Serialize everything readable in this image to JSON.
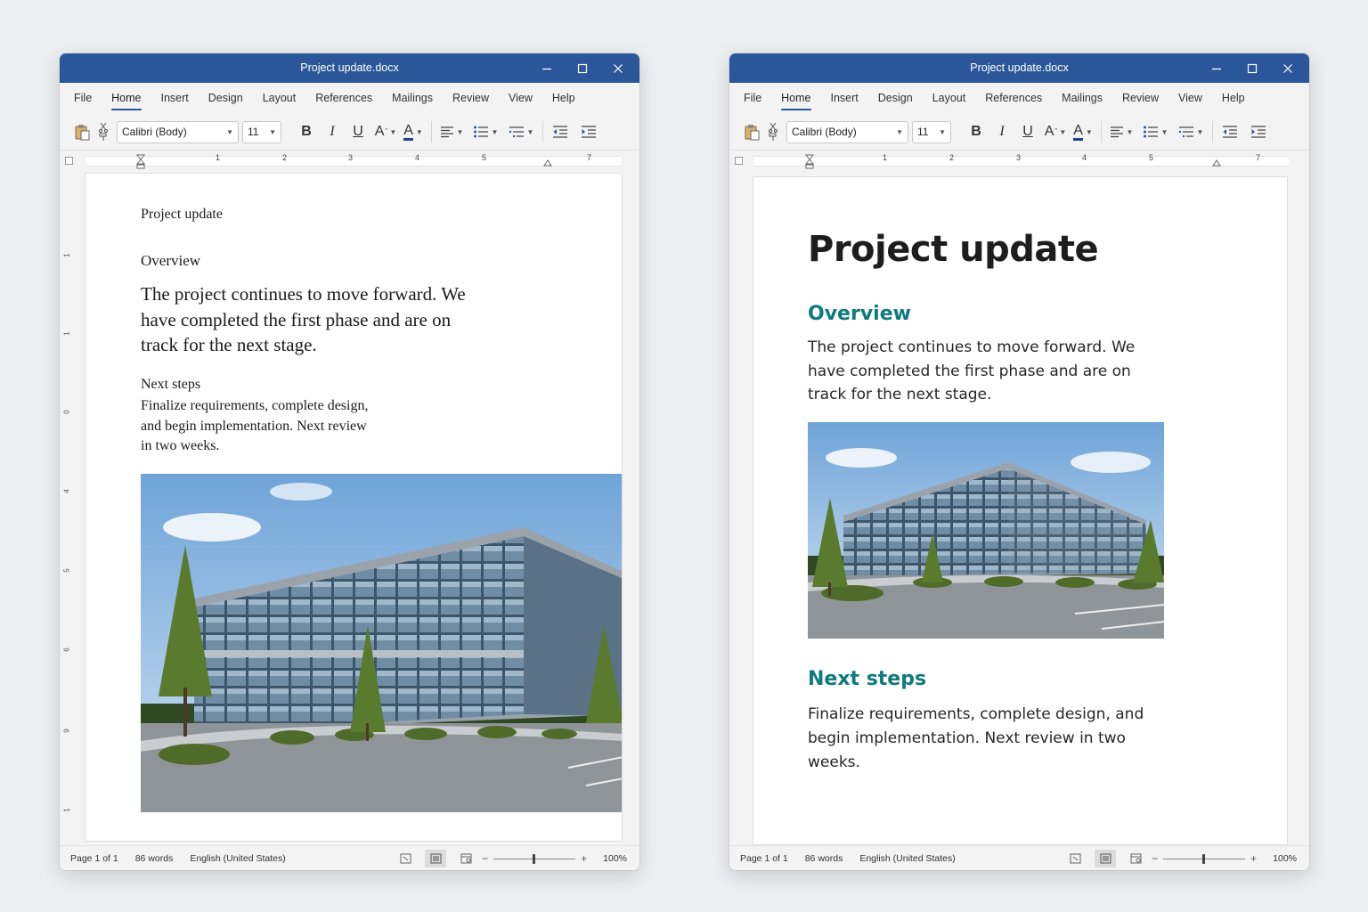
{
  "windows": [
    {
      "id": "left",
      "title": "Project update.docx",
      "menu": [
        "File",
        "Home",
        "Insert",
        "Design",
        "Layout",
        "References",
        "Mailings",
        "Review",
        "View",
        "Help"
      ],
      "active_menu": "Home",
      "font_name": "Calibri (Body)",
      "font_size": "11",
      "ruler_numbers": [
        "1",
        "2",
        "3",
        "4",
        "5",
        "7"
      ],
      "vruler_numbers": [
        "1",
        "1",
        "0",
        "4",
        "5",
        "6",
        "9",
        "1"
      ],
      "document": {
        "title": "Project update",
        "overview_heading": "Overview",
        "overview_text": "The project continues to move forward. We have completed the first phase and are on track for the next stage.",
        "next_heading": "Next steps",
        "next_text": "Finalize requirements, complete design, and begin implementation. Next review in two weeks."
      },
      "status": {
        "page": "Page 1 of 1",
        "words": "86 words",
        "language": "English (United States)",
        "zoom": "100%",
        "zoom_level_percent": 100
      }
    },
    {
      "id": "right",
      "title": "Project update.docx",
      "menu": [
        "File",
        "Home",
        "Insert",
        "Design",
        "Layout",
        "References",
        "Mailings",
        "Review",
        "View",
        "Help"
      ],
      "active_menu": "Home",
      "font_name": "Calibri (Body)",
      "font_size": "11",
      "ruler_numbers": [
        "1",
        "2",
        "3",
        "4",
        "5",
        "7"
      ],
      "document": {
        "title": "Project update",
        "overview_heading": "Overview",
        "overview_text": "The project continues to move forward. We have completed the first phase and are on track for the next stage.",
        "next_heading": "Next steps",
        "next_text": "Finalize requirements, complete design, and begin implementation. Next review in two weeks."
      },
      "status": {
        "page": "Page 1 of 1",
        "words": "86 words",
        "language": "English (United States)",
        "zoom": "100%",
        "zoom_level_percent": 100
      }
    }
  ],
  "colors": {
    "titlebar": "#2b579a",
    "heading_teal": "#0f7a7d",
    "font_color_underline": "#1f3f9c"
  },
  "icons": [
    "paste-icon",
    "cut-icon",
    "format-painter-icon",
    "minimize-icon",
    "maximize-icon",
    "close-icon",
    "align-left-icon",
    "bullets-icon",
    "multilevel-list-icon",
    "decrease-indent-icon",
    "increase-indent-icon",
    "read-mode-icon",
    "print-layout-icon",
    "web-layout-icon"
  ]
}
